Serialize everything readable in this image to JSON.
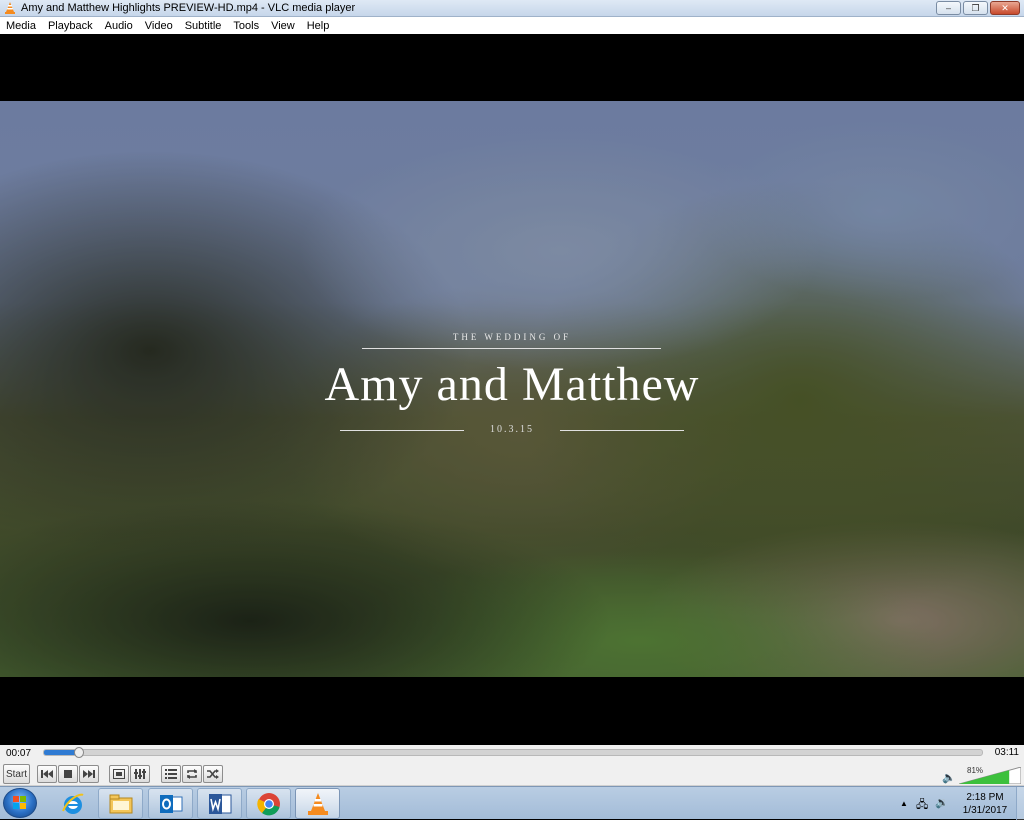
{
  "window": {
    "title": "Amy and Matthew Highlights PREVIEW-HD.mp4 - VLC media player",
    "minimize_label": "–",
    "maximize_label": "❐",
    "close_label": "✕"
  },
  "menu": [
    "Media",
    "Playback",
    "Audio",
    "Video",
    "Subtitle",
    "Tools",
    "View",
    "Help"
  ],
  "video": {
    "pre_title": "THE WEDDING OF",
    "names": "Amy and Matthew",
    "date": "10.3.15"
  },
  "playback": {
    "elapsed": "00:07",
    "total": "03:11",
    "progress_fraction": 0.037
  },
  "controls": {
    "start_label": "Start",
    "icons": [
      "previous-icon",
      "stop-icon",
      "next-icon",
      "fullscreen-icon",
      "extended-settings-icon",
      "playlist-icon",
      "loop-icon",
      "shuffle-icon"
    ]
  },
  "volume": {
    "percent_label": "81%",
    "level": 0.81,
    "color": "#3cc03c"
  },
  "taskbar": {
    "apps": [
      "internet-explorer-icon",
      "file-explorer-icon",
      "outlook-icon",
      "word-icon",
      "chrome-icon",
      "vlc-icon"
    ],
    "time": "2:18 PM",
    "date": "1/31/2017"
  },
  "colors": {
    "vlc_orange": "#f58b1f",
    "seek_fill": "#2f7bd3"
  }
}
